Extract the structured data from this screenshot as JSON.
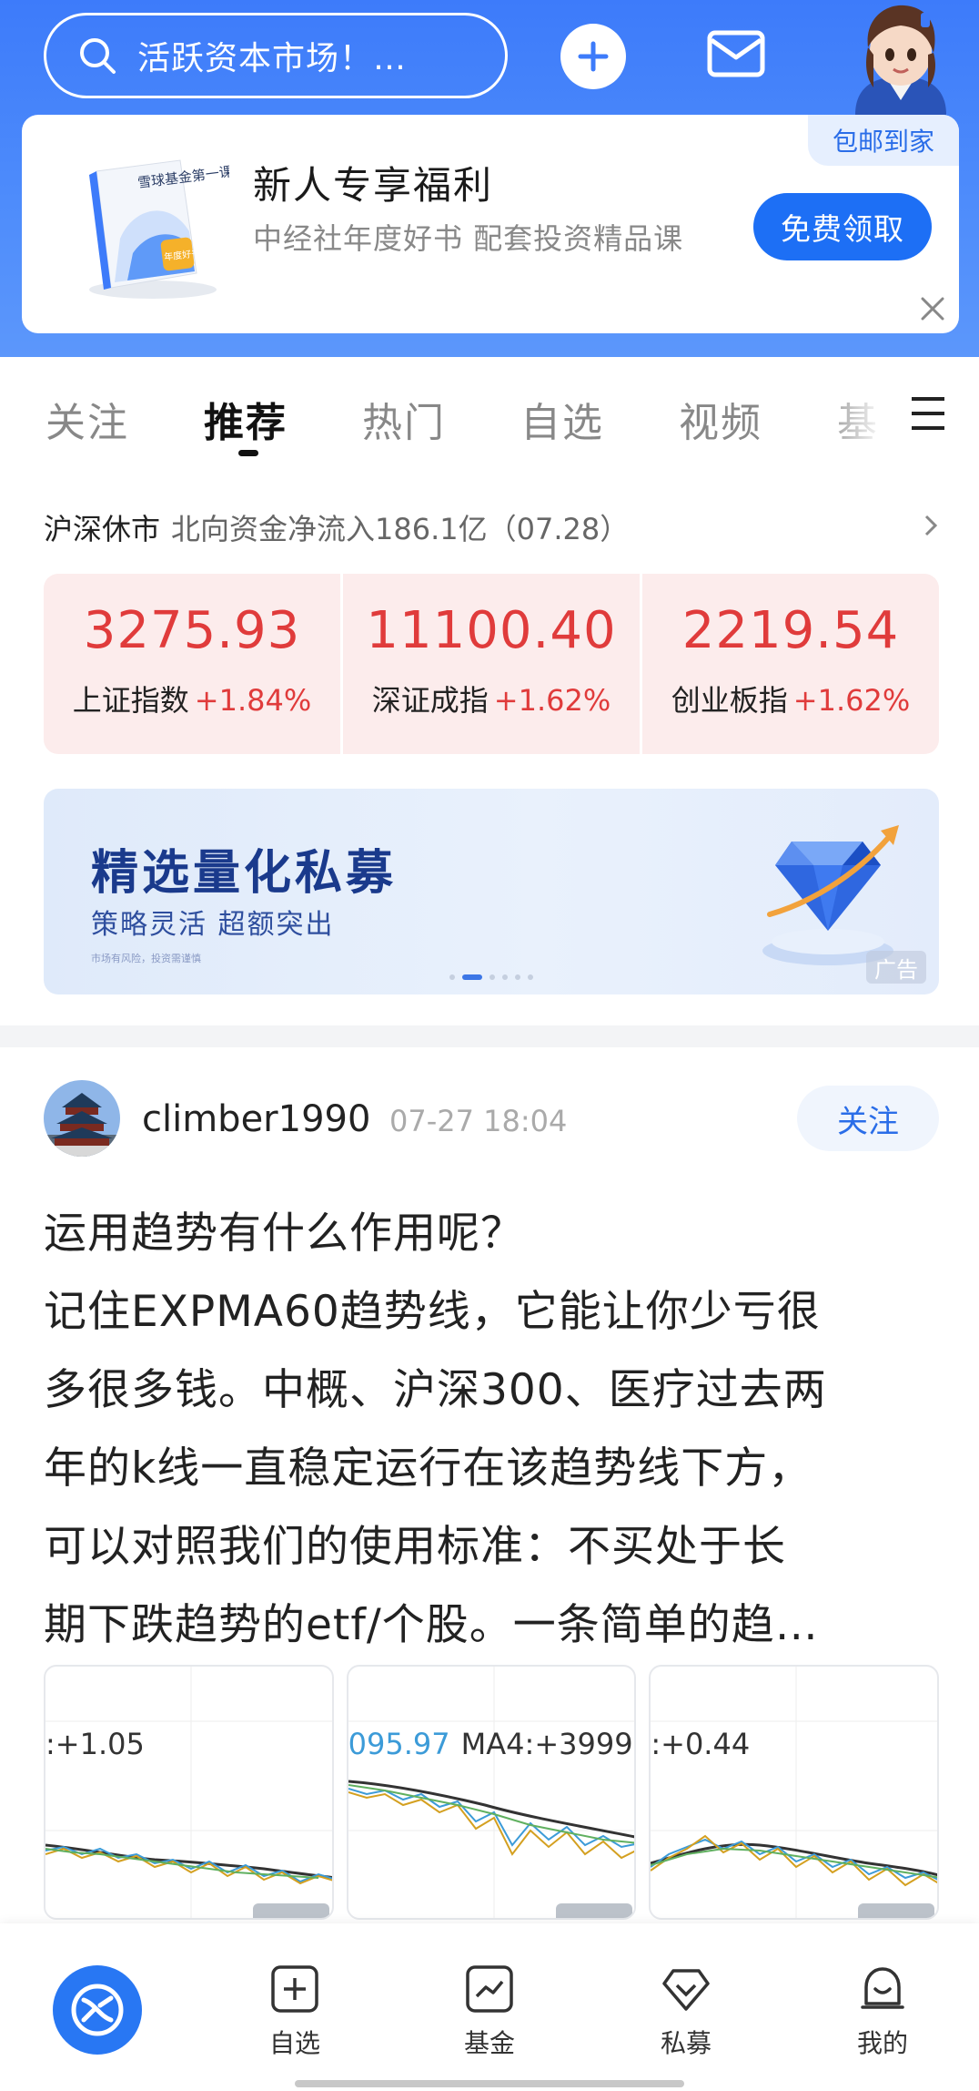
{
  "search": {
    "placeholder": "活跃资本市场！…"
  },
  "promo": {
    "title": "新人专享福利",
    "desc": "中经社年度好书 配套投资精品课",
    "cta": "免费领取",
    "ship_badge": "包邮到家",
    "book_title": "雪球基金第一课",
    "book_badge": "年度好书"
  },
  "tabs": [
    "关注",
    "推荐",
    "热门",
    "自选",
    "视频",
    "基"
  ],
  "market": {
    "status": "沪深休市",
    "info": "北向资金净流入186.1亿（07.28）",
    "indices": [
      {
        "value": "3275.93",
        "name": "上证指数",
        "change": "+1.84%"
      },
      {
        "value": "11100.40",
        "name": "深证成指",
        "change": "+1.62%"
      },
      {
        "value": "2219.54",
        "name": "创业板指",
        "change": "+1.62%"
      }
    ]
  },
  "banner": {
    "headline": "精选量化私募",
    "sub": "策略灵活 超额突出",
    "fine_print": "市场有风险，投资需谨慎",
    "ad_label": "广告"
  },
  "post": {
    "user": "climber1990",
    "time": "07-27 18:04",
    "follow_label": "关注",
    "lines": [
      "运用趋势有什么作用呢？",
      "记住EXPMA60趋势线，它能让你少亏很",
      "多很多钱。中概、沪深300、医疗过去两",
      "年的k线一直稳定运行在该趋势线下方，",
      "可以对照我们的使用标准：不买处于长",
      "期下跌趋势的etf/个股。一条简单的趋…"
    ],
    "thumbs": [
      {
        "label": ":+1.05"
      },
      {
        "label_a": "095.97",
        "label_b": "MA4:+3999."
      },
      {
        "label": ":+0.44"
      }
    ]
  },
  "bottom_nav": [
    {
      "label": "自选",
      "icon": "plus-square-icon"
    },
    {
      "label": "基金",
      "icon": "chart-icon"
    },
    {
      "label": "私募",
      "icon": "diamond-icon"
    },
    {
      "label": "我的",
      "icon": "user-icon"
    }
  ],
  "colors": {
    "brand_blue": "#3d7bfa",
    "up_red": "#e03b3b",
    "accent": "#1d6ff5"
  }
}
